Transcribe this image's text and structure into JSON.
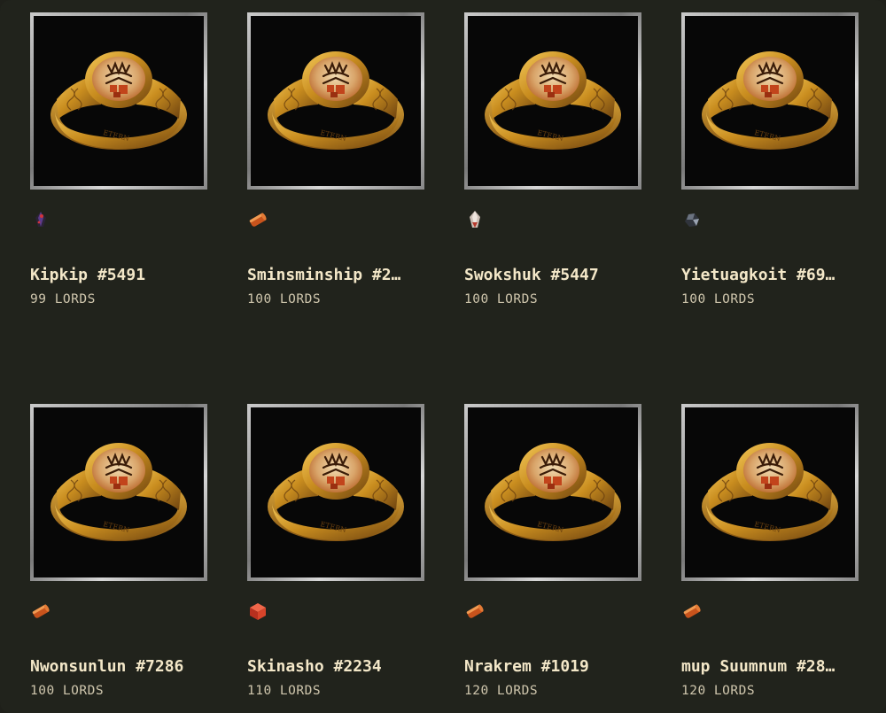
{
  "listings": [
    {
      "name": "Kipkip #5491",
      "price": "99 LORDS",
      "gem": "dark-gem-icon"
    },
    {
      "name": "Sminsminship #2…",
      "price": "100 LORDS",
      "gem": "copper-bar-icon"
    },
    {
      "name": "Swokshuk #5447",
      "price": "100 LORDS",
      "gem": "pale-gem-icon"
    },
    {
      "name": "Yietuagkoit #69…",
      "price": "100 LORDS",
      "gem": "ore-chunk-icon"
    },
    {
      "name": "Nwonsunlun #7286",
      "price": "100 LORDS",
      "gem": "copper-bar-icon"
    },
    {
      "name": "Skinasho #2234",
      "price": "110 LORDS",
      "gem": "ruby-cube-icon"
    },
    {
      "name": "Nrakrem #1019",
      "price": "120 LORDS",
      "gem": "copper-bar-icon"
    },
    {
      "name": "mup Suumnum #28…",
      "price": "120 LORDS",
      "gem": "copper-bar-icon"
    }
  ]
}
